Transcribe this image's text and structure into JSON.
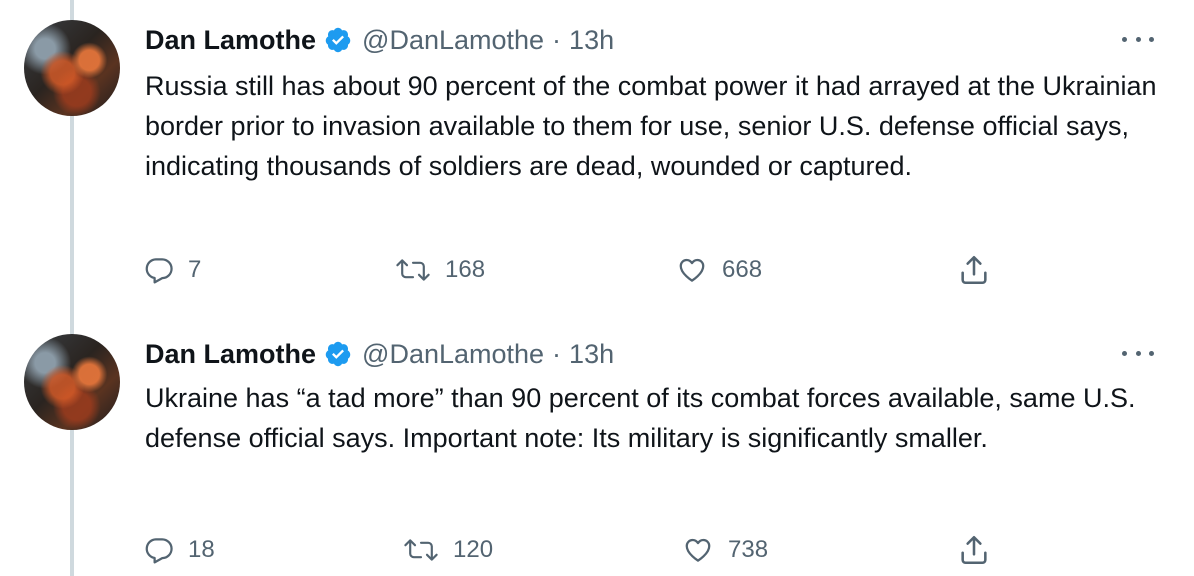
{
  "tweets": [
    {
      "author": {
        "name": "Dan Lamothe",
        "handle": "@DanLamothe",
        "verified": true
      },
      "time": "13h",
      "text": "Russia still has about 90 percent of the combat power it had arrayed at the Ukrainian border prior to invasion available to them for use, senior U.S. defense official says, indicating thousands of soldiers are dead, wounded or captured.",
      "actions": {
        "replies": "7",
        "retweets": "168",
        "likes": "668"
      }
    },
    {
      "author": {
        "name": "Dan Lamothe",
        "handle": "@DanLamothe",
        "verified": true
      },
      "time": "13h",
      "text": "Ukraine has “a tad more” than 90 percent of its combat forces available, same U.S. defense official says. Important note: Its military is significantly smaller.",
      "actions": {
        "replies": "18",
        "retweets": "120",
        "likes": "738"
      }
    }
  ],
  "separator": "·",
  "icons": {
    "verified": "verified-badge-icon",
    "more": "more-dots-icon",
    "reply": "reply-bubble-icon",
    "retweet": "retweet-icon",
    "like": "heart-icon",
    "share": "share-upload-icon"
  },
  "colors": {
    "verified": "#1d9bf0",
    "secondary": "#536471",
    "text": "#0f1419",
    "thread_line": "#cfd9de"
  }
}
